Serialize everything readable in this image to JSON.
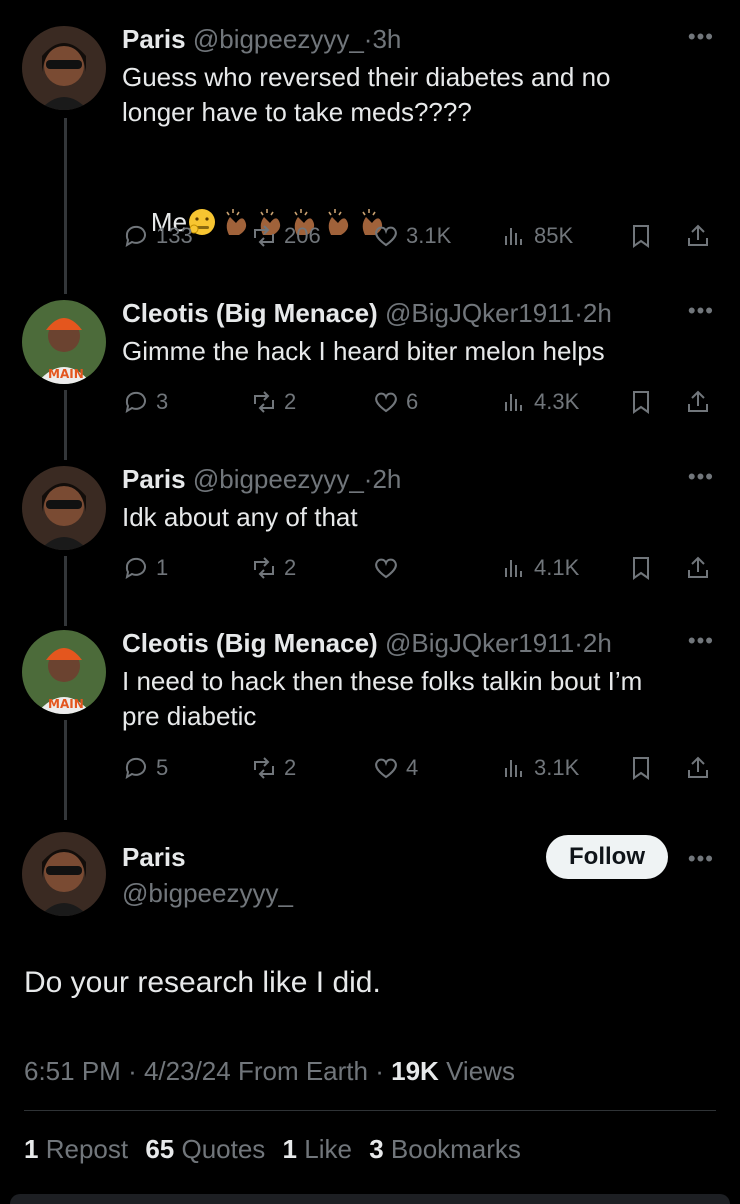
{
  "thread": [
    {
      "name": "Paris",
      "handle": "@bigpeezyyy_",
      "time": "3h",
      "text": "Guess who reversed their diabetes and no\nlonger have to take meds????",
      "text2": "Me",
      "emojis": [
        "zipper-mouth-face",
        "clapping-hands",
        "clapping-hands",
        "clapping-hands",
        "clapping-hands",
        "clapping-hands"
      ],
      "replies": "133",
      "reposts": "206",
      "likes": "3.1K",
      "views": "85K"
    },
    {
      "name": "Cleotis (Big Menace)",
      "handle": "@BigJQker1911",
      "time": "2h",
      "text": "Gimme the hack I heard biter melon helps",
      "replies": "3",
      "reposts": "2",
      "likes": "6",
      "views": "4.3K"
    },
    {
      "name": "Paris",
      "handle": "@bigpeezyyy_",
      "time": "2h",
      "text": "Idk about any of that",
      "replies": "1",
      "reposts": "2",
      "likes": "",
      "views": "4.1K"
    },
    {
      "name": "Cleotis (Big Menace)",
      "handle": "@BigJQker1911",
      "time": "2h",
      "text": "I need to hack then these folks talkin bout I’m\npre diabetic",
      "replies": "5",
      "reposts": "2",
      "likes": "4",
      "views": "3.1K"
    }
  ],
  "main": {
    "name": "Paris",
    "handle": "@bigpeezyyy_",
    "follow_label": "Follow",
    "text": "Do your research like I did.",
    "time": "6:51 PM",
    "date": "4/23/24",
    "source": "From Earth",
    "views_count": "19K",
    "views_label": "Views",
    "reposts_count": "1",
    "reposts_label": "Repost",
    "quotes_count": "65",
    "quotes_label": "Quotes",
    "likes_count": "1",
    "likes_label": "Like",
    "bookmarks_count": "3",
    "bookmarks_label": "Bookmarks"
  },
  "separator": "·",
  "more_glyph": "•••",
  "colors": {
    "background": "#000000",
    "text": "#e7e9ea",
    "muted": "#71767b",
    "follow_bg": "#eff3f4"
  }
}
